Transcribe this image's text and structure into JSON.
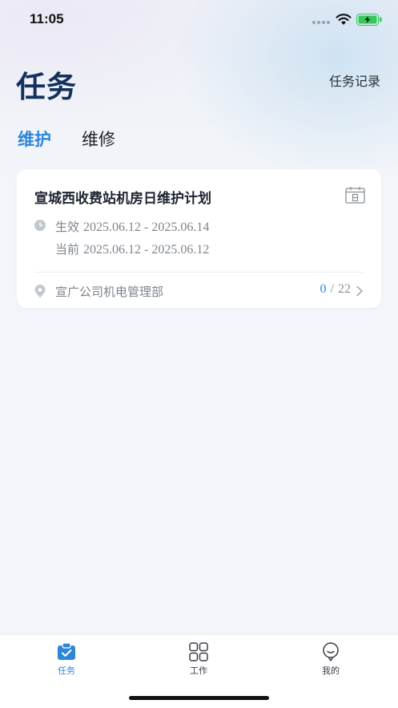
{
  "status_bar": {
    "time": "11:05"
  },
  "header": {
    "title": "任务",
    "history_link": "任务记录"
  },
  "tabs": [
    {
      "label": "维护",
      "active": true
    },
    {
      "label": "维修",
      "active": false
    }
  ],
  "task_card": {
    "title": "宣城西收费站机房日维护计划",
    "effective_label": "生效",
    "effective_range": "2025.06.12 - 2025.06.14",
    "current_label": "当前",
    "current_range": "2025.06.12 - 2025.06.12",
    "department": "宣广公司机电管理部",
    "progress_done": "0",
    "progress_separator": "/",
    "progress_total": "22"
  },
  "bottom_nav": {
    "items": [
      {
        "label": "任务",
        "icon": "task-icon",
        "active": true
      },
      {
        "label": "工作",
        "icon": "grid-icon",
        "active": false
      },
      {
        "label": "我的",
        "icon": "profile-icon",
        "active": false
      }
    ]
  },
  "colors": {
    "accent": "#2f86d9",
    "title": "#13315c",
    "muted": "#7e858d",
    "background": "#f2f5f9",
    "card": "#ffffff"
  }
}
